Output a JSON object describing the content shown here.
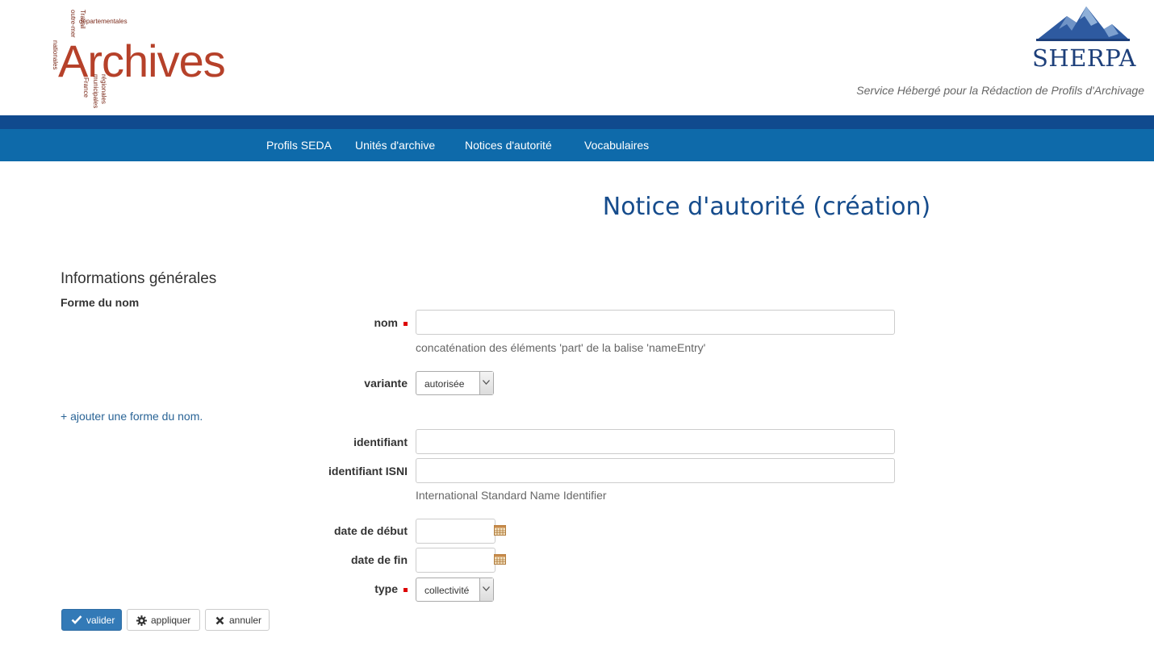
{
  "header": {
    "logo_left": {
      "main": "Archives",
      "words": [
        "départementales",
        "outre-mer",
        "Travail",
        "nationales",
        "régionales",
        "municipales",
        "France"
      ]
    },
    "logo_right": {
      "name": "SHERPA"
    },
    "tagline": "Service Hébergé pour la Rédaction de Profils d'Archivage"
  },
  "nav": {
    "items": [
      "Profils SEDA",
      "Unités d'archive",
      "Notices d'autorité",
      "Vocabulaires"
    ]
  },
  "page_title": "Notice d'autorité (création)",
  "section": {
    "title": "Informations générales",
    "subtitle": "Forme du nom"
  },
  "form": {
    "nom": {
      "label": "nom",
      "value": "",
      "help": "concaténation des éléments 'part' de la balise 'nameEntry'"
    },
    "variante": {
      "label": "variante",
      "selected": "autorisée"
    },
    "add_link": "+ ajouter une forme du nom.",
    "identifiant": {
      "label": "identifiant",
      "value": ""
    },
    "isni": {
      "label": "identifiant ISNI",
      "value": "",
      "help": "International Standard Name Identifier"
    },
    "date_debut": {
      "label": "date de début",
      "value": ""
    },
    "date_fin": {
      "label": "date de fin",
      "value": ""
    },
    "type": {
      "label": "type",
      "selected": "collectivité"
    }
  },
  "buttons": {
    "validate": "valider",
    "apply": "appliquer",
    "cancel": "annuler"
  },
  "colors": {
    "nav": "#0e6aaa",
    "nav_top": "#104a8e",
    "title": "#164c8c",
    "primary": "#337ab7",
    "required": "#dd0000"
  }
}
